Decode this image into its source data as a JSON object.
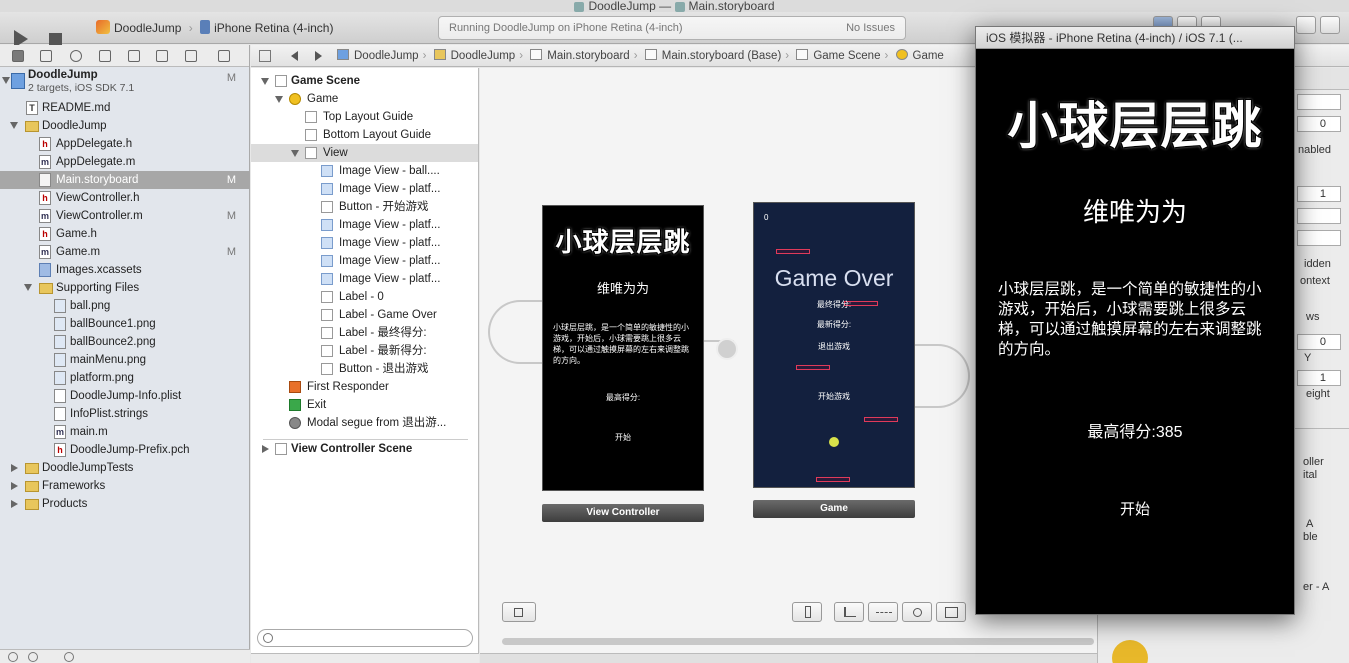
{
  "window": {
    "title": "DoodleJump — ",
    "title_file": "Main.storyboard"
  },
  "toolbar": {
    "scheme_target": "DoodleJump",
    "scheme_device": "iPhone Retina (4-inch)",
    "activity_text": "Running DoodleJump on iPhone Retina (4-inch)",
    "issues_text": "No Issues"
  },
  "jumpbar": {
    "crumbs": [
      "DoodleJump",
      "DoodleJump",
      "Main.storyboard",
      "Main.storyboard (Base)",
      "Game Scene",
      "Game"
    ]
  },
  "navigator": {
    "project_name": "DoodleJump",
    "project_sub": "2 targets, iOS SDK 7.1",
    "project_badge": "M",
    "items": [
      {
        "label": "README.md",
        "badge": ""
      },
      {
        "label": "DoodleJump",
        "badge": ""
      },
      {
        "label": "AppDelegate.h",
        "badge": ""
      },
      {
        "label": "AppDelegate.m",
        "badge": ""
      },
      {
        "label": "Main.storyboard",
        "badge": "M"
      },
      {
        "label": "ViewController.h",
        "badge": ""
      },
      {
        "label": "ViewController.m",
        "badge": "M"
      },
      {
        "label": "Game.h",
        "badge": ""
      },
      {
        "label": "Game.m",
        "badge": "M"
      },
      {
        "label": "Images.xcassets",
        "badge": ""
      },
      {
        "label": "Supporting Files",
        "badge": ""
      },
      {
        "label": "ball.png",
        "badge": ""
      },
      {
        "label": "ballBounce1.png",
        "badge": ""
      },
      {
        "label": "ballBounce2.png",
        "badge": ""
      },
      {
        "label": "mainMenu.png",
        "badge": ""
      },
      {
        "label": "platform.png",
        "badge": ""
      },
      {
        "label": "DoodleJump-Info.plist",
        "badge": ""
      },
      {
        "label": "InfoPlist.strings",
        "badge": ""
      },
      {
        "label": "main.m",
        "badge": ""
      },
      {
        "label": "DoodleJump-Prefix.pch",
        "badge": ""
      },
      {
        "label": "DoodleJumpTests",
        "badge": ""
      },
      {
        "label": "Frameworks",
        "badge": ""
      },
      {
        "label": "Products",
        "badge": ""
      }
    ]
  },
  "outline": {
    "items": [
      {
        "label": "Game Scene"
      },
      {
        "label": "Game"
      },
      {
        "label": "Top Layout Guide"
      },
      {
        "label": "Bottom Layout Guide"
      },
      {
        "label": "View"
      },
      {
        "label": "Image View - ball...."
      },
      {
        "label": "Image View - platf..."
      },
      {
        "label": "Button - 开始游戏"
      },
      {
        "label": "Image View - platf..."
      },
      {
        "label": "Image View - platf..."
      },
      {
        "label": "Image View - platf..."
      },
      {
        "label": "Image View - platf..."
      },
      {
        "label": "Label - 0"
      },
      {
        "label": "Label - Game Over"
      },
      {
        "label": "Label - 最终得分:"
      },
      {
        "label": "Label - 最新得分:"
      },
      {
        "label": "Button - 退出游戏"
      },
      {
        "label": "First Responder"
      },
      {
        "label": "Exit"
      },
      {
        "label": "Modal segue from 退出游..."
      },
      {
        "label": "View Controller Scene"
      }
    ]
  },
  "canvas": {
    "vc_scene": {
      "logo": "小球层层跳",
      "author": "维唯为为",
      "desc": "小球层层跳，是一个简单的敏捷性的小游戏，开始后，小球需要跳上很多云梯，可以通过触摸屏幕的左右来调整跳的方向。",
      "best": "最高得分:",
      "start": "开始",
      "label": "View Controller"
    },
    "game_scene": {
      "score": "0",
      "game_over": "Game Over",
      "final_score": "最终得分:",
      "latest_score": "最新得分:",
      "quit": "退出游戏",
      "start_game": "开始游戏",
      "label": "Game"
    }
  },
  "inspector": {
    "values": [
      "0",
      "1",
      "0",
      "1"
    ],
    "fragments": [
      "nabled",
      "idden",
      "ontext",
      "ws",
      "Y",
      "eight",
      "oller",
      "ital",
      "A",
      "ble",
      "er - A"
    ]
  },
  "simulator": {
    "title": "iOS 模拟器 - iPhone Retina (4-inch) / iOS 7.1 (...",
    "logo": "小球层层跳",
    "author": "维唯为为",
    "desc": "小球层层跳，是一个简单的敏捷性的小游戏，开始后，小球需要跳上很多云梯，可以通过触摸屏幕的左右来调整跳的方向。",
    "best": "最高得分:385",
    "start": "开始"
  },
  "colors": {
    "selection": "#a7a7a7",
    "game_bg": "#13203e",
    "platform": "#e03a5a",
    "ball": "#d8e24a"
  }
}
